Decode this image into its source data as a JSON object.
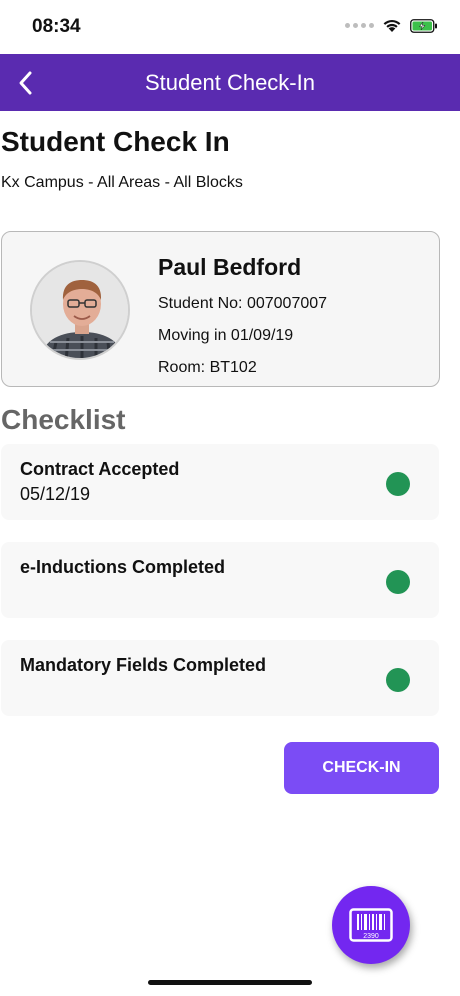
{
  "status_bar": {
    "time": "08:34",
    "icons": [
      "signal-icon",
      "wifi-icon",
      "battery-charging-icon"
    ],
    "battery_color": "#3cc04a"
  },
  "app_bar": {
    "title": "Student Check-In",
    "back_icon": "chevron-left-icon",
    "background_color": "#5a2bb0"
  },
  "page": {
    "title": "Student Check In",
    "subtitle": "Kx Campus - All Areas - All Blocks"
  },
  "student": {
    "name": "Paul Bedford",
    "student_no": "Student No: 007007007",
    "moving_in": "Moving in 01/09/19",
    "room": "Room: BT102",
    "avatar_icon": "student-photo"
  },
  "checklist": {
    "heading": "Checklist",
    "items": [
      {
        "title": "Contract Accepted",
        "date": "05/12/19",
        "status": "complete"
      },
      {
        "title": "e-Inductions Completed",
        "date": "",
        "status": "complete"
      },
      {
        "title": "Mandatory Fields Completed",
        "date": "",
        "status": "complete"
      }
    ],
    "status_color": "#229455"
  },
  "actions": {
    "checkin_label": "CHECK-IN",
    "checkin_color": "#7b4cf5",
    "scan_icon": "barcode-scan-icon",
    "scan_digits": "2390"
  }
}
